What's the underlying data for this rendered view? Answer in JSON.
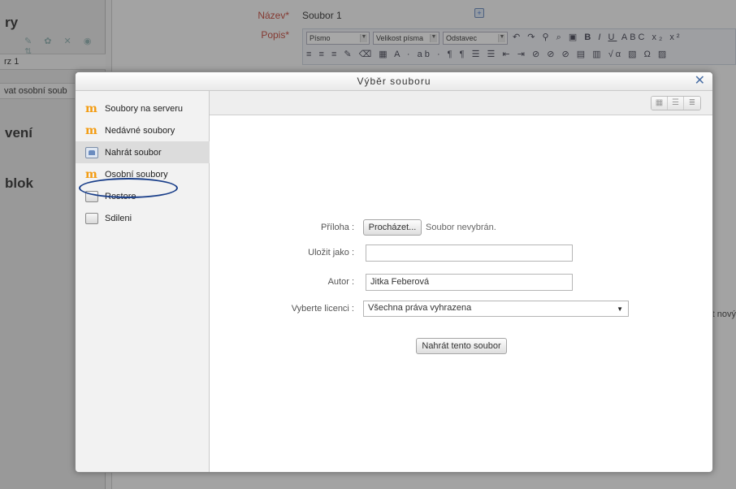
{
  "background": {
    "left_panel": {
      "block1_title": "ry",
      "row1": "rz 1",
      "row2": "vat osobní soub",
      "block2_title": "vení",
      "block3_title": "blok",
      "icons": "✎ ✿ ✕ ◉ ⇅"
    },
    "form": {
      "nazev_label": "Název*",
      "nazev_value": "Soubor 1",
      "popis_label": "Popis*"
    },
    "toolbar": {
      "font_select": "Písmo",
      "size_select": "Velikost písma",
      "format_select": "Odstavec"
    },
    "side_text": "t nový"
  },
  "modal": {
    "title": "Výběr souboru",
    "close_icon": "close-icon",
    "repositories": [
      {
        "label": "Soubory na serveru",
        "icon": "moodle-icon"
      },
      {
        "label": "Nedávné soubory",
        "icon": "moodle-icon"
      },
      {
        "label": "Nahrát soubor",
        "icon": "upload-icon",
        "active": true
      },
      {
        "label": "Osobní soubory",
        "icon": "moodle-icon",
        "highlighted": true
      },
      {
        "label": "Restore",
        "icon": "repository-icon"
      },
      {
        "label": "Sdileni",
        "icon": "repository-icon"
      }
    ],
    "view_buttons": [
      "icons-view-icon",
      "list-view-icon",
      "tree-view-icon"
    ],
    "upload_form": {
      "attachment_label": "Příloha :",
      "browse_button": "Procházet...",
      "no_file_text": "Soubor nevybrán.",
      "save_as_label": "Uložit jako :",
      "save_as_value": "",
      "author_label": "Autor :",
      "author_value": "Jitka Feberová",
      "license_label": "Vyberte licenci :",
      "license_value": "Všechna práva vyhrazena",
      "upload_button": "Nahrát tento soubor"
    }
  },
  "colors": {
    "required_label": "#c0392b",
    "close_icon": "#4a6fa5",
    "highlight_ring": "#1a3f8a",
    "repo_icon": "#f39c12"
  }
}
